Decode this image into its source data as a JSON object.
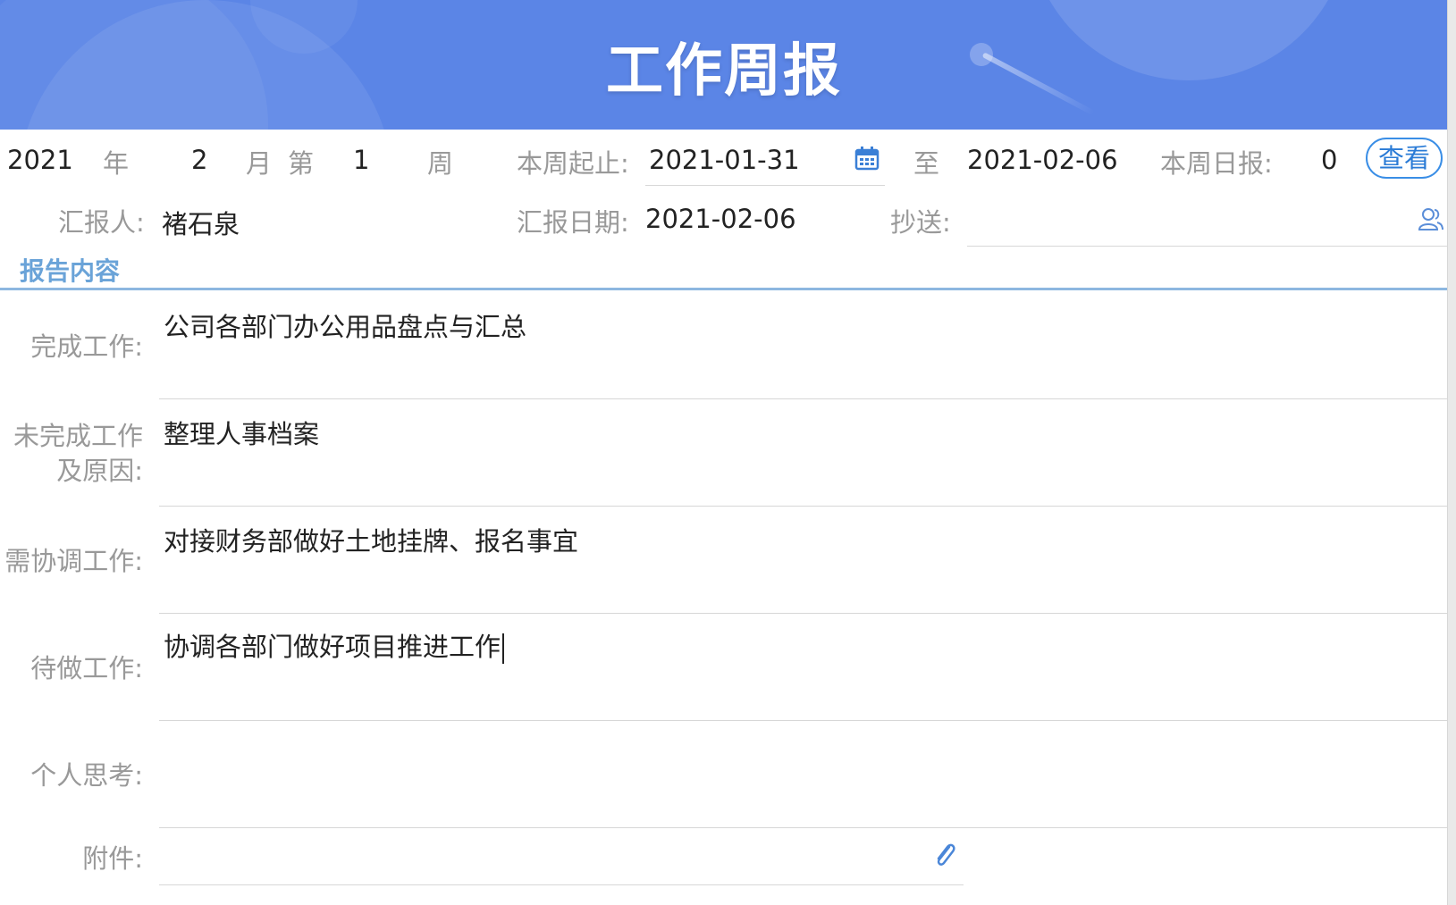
{
  "banner": {
    "title": "工作周报"
  },
  "week": {
    "year": "2021",
    "year_unit": "年",
    "month": "2",
    "month_unit": "月",
    "week_prefix": "第",
    "week_number": "1",
    "week_unit": "周",
    "range_label": "本周起止:",
    "start_date": "2021-01-31",
    "to_label": "至",
    "end_date": "2021-02-06",
    "daily_label": "本周日报:",
    "daily_count": "0",
    "view_button": "查看"
  },
  "reporter": {
    "label": "汇报人:",
    "name": "褚石泉",
    "date_label": "汇报日期:",
    "date": "2021-02-06",
    "cc_label": "抄送:",
    "cc_value": ""
  },
  "report": {
    "section_title": "报告内容",
    "completed_label": "完成工作:",
    "completed": "公司各部门办公用品盘点与汇总",
    "incomplete_label_1": "未完成工作",
    "incomplete_label_2": "及原因:",
    "incomplete": "整理人事档案",
    "coordinate_label": "需协调工作:",
    "coordinate": "对接财务部做好土地挂牌、报名事宜",
    "todo_label": "待做工作:",
    "todo": "协调各部门做好项目推进工作",
    "thoughts_label": "个人思考:",
    "thoughts": "",
    "attachment_label": "附件:"
  },
  "colors": {
    "banner": "#5b85e6",
    "accent": "#3a8ee6",
    "section_title": "#6aa3d8",
    "label": "#999999"
  },
  "icons": [
    "calendar-icon",
    "contacts-icon",
    "paperclip-icon"
  ]
}
